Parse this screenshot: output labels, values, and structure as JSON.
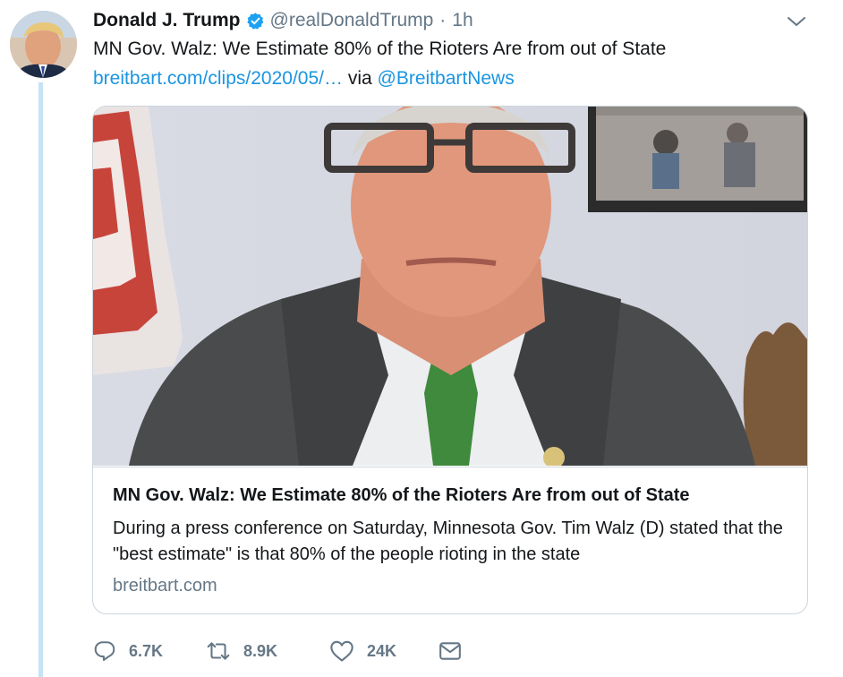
{
  "user": {
    "display_name": "Donald J. Trump",
    "handle": "@realDonaldTrump",
    "separator": "·",
    "time": "1h"
  },
  "tweet": {
    "text": "MN Gov. Walz: We Estimate 80% of the Rioters Are from out of State",
    "link": "breitbart.com/clips/2020/05/…",
    "via_word": "via",
    "via_handle": "@BreitbartNews"
  },
  "card": {
    "title": "MN Gov. Walz: We Estimate 80% of the Rioters Are from out of State",
    "description": "During a press conference on Saturday, Minnesota Gov. Tim Walz (D) stated that the \"best estimate\" is that 80% of the people rioting in the state",
    "domain": "breitbart.com"
  },
  "actions": {
    "replies": "6.7K",
    "retweets": "8.9K",
    "likes": "24K"
  },
  "icons": {
    "verified": "verified-badge-icon",
    "caret": "chevron-down-icon",
    "reply": "reply-icon",
    "retweet": "retweet-icon",
    "like": "heart-icon",
    "dm": "envelope-icon"
  },
  "colors": {
    "link": "#1b95e0",
    "muted": "#657786",
    "thread_line": "#c4e3f7",
    "border": "#ccd6dd"
  }
}
